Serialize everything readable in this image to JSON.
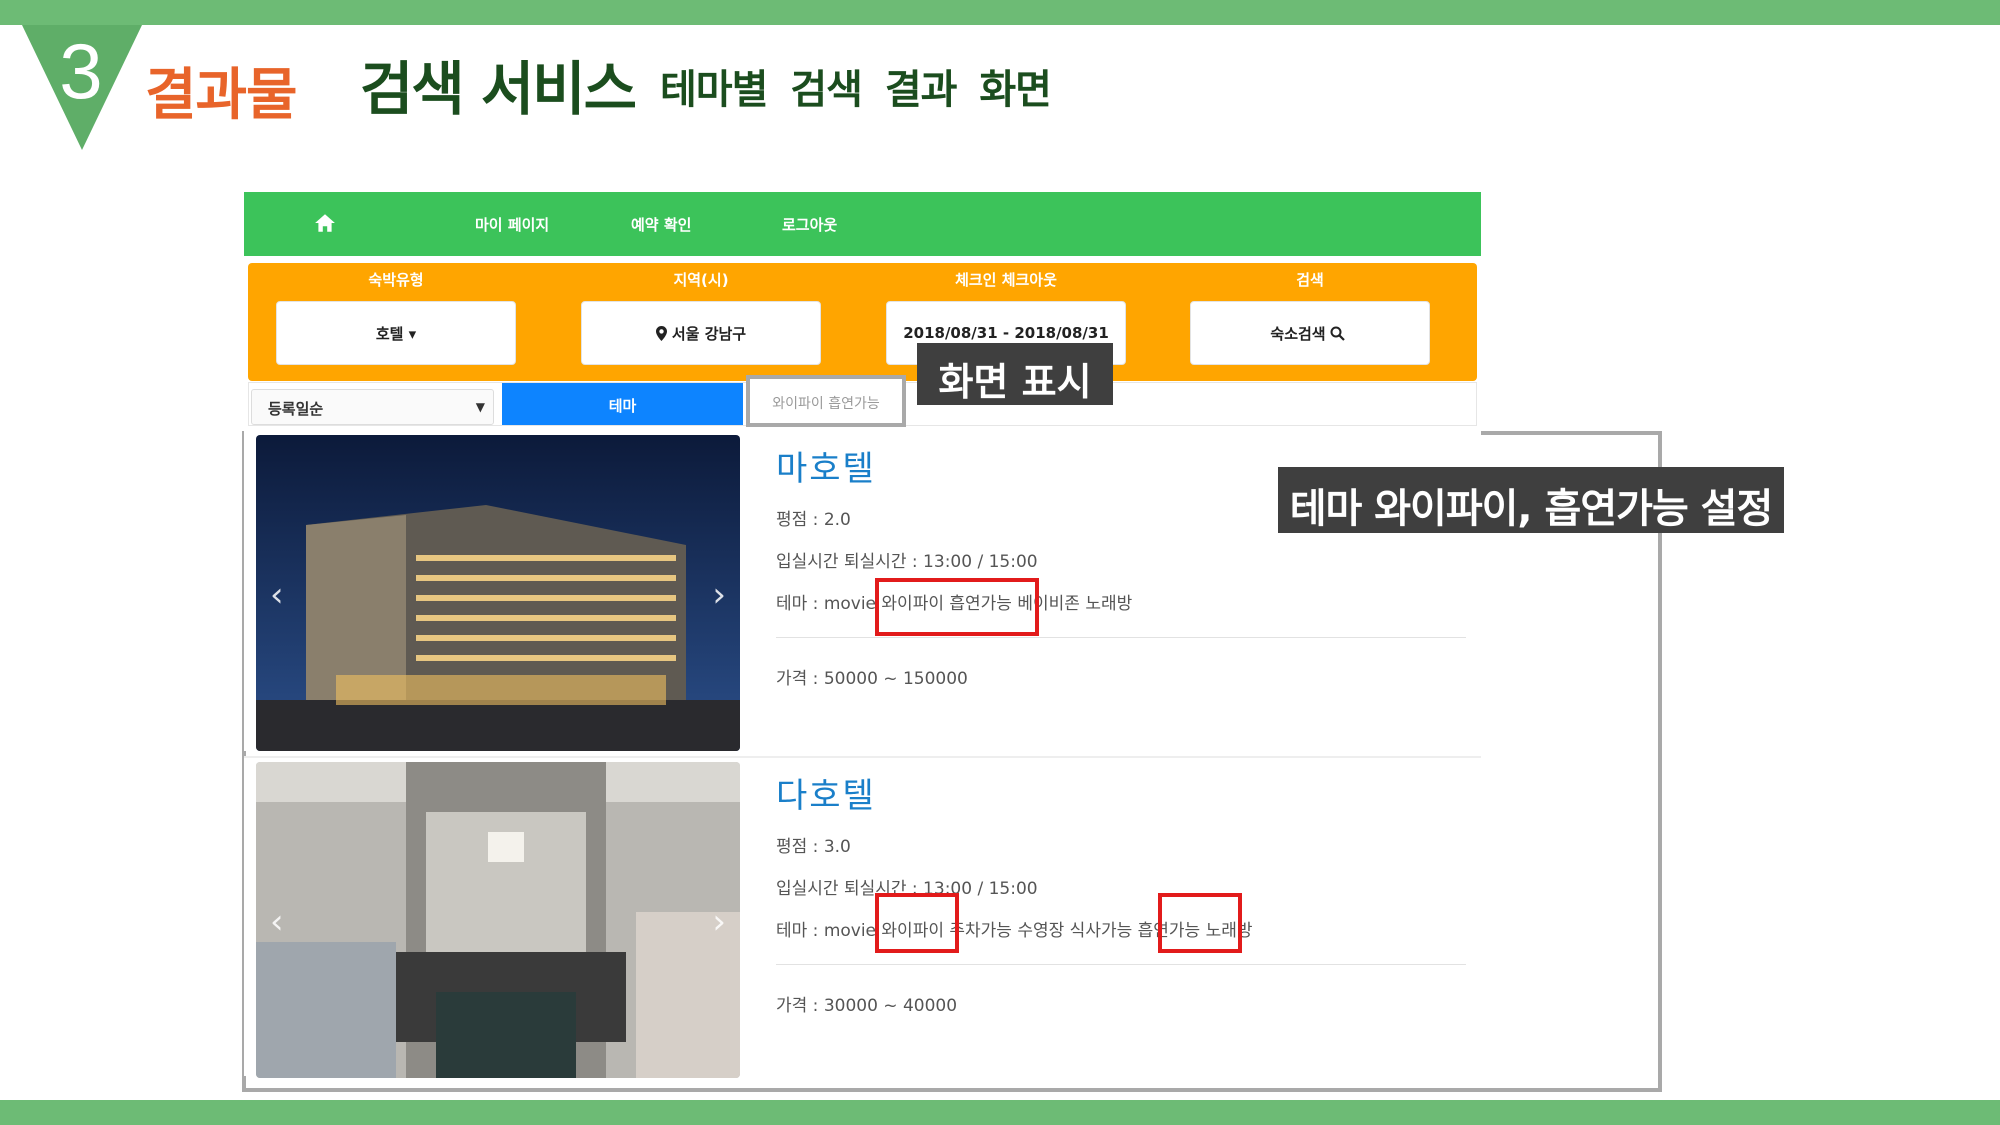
{
  "slide": {
    "section_number": "3",
    "section_title": "결과물",
    "title": "검색 서비스",
    "subtitle": "테마별  검색 결과 화면"
  },
  "nav": {
    "home_icon": "home-icon",
    "links": [
      "마이 페이지",
      "예약 확인",
      "로그아웃"
    ]
  },
  "search": {
    "fields": [
      {
        "label": "숙박유형",
        "value": "호텔 ▾"
      },
      {
        "label": "지역(시)",
        "value": "서울 강남구",
        "icon": "map-pin-icon"
      },
      {
        "label": "체크인 체크아웃",
        "value": "2018/08/31 - 2018/08/31"
      },
      {
        "label": "검색",
        "value": "숙소검색",
        "icon": "search-icon"
      }
    ]
  },
  "filter": {
    "sort_value": "등록일순",
    "theme_button": "테마",
    "theme_tag": "와이파이 흡연가능"
  },
  "callouts": {
    "screen": "화면 표시",
    "theme_setting": "테마 와이파이, 흡연가능 설정"
  },
  "hotels": [
    {
      "name": "마호텔",
      "rating": "평점 : 2.0",
      "times": "입실시간 퇴실시간 : 13:00 / 15:00",
      "themes": "테마 : movie 와이파이 흡연가능 베이비존 노래방",
      "price": "가격 : 50000 ~ 150000"
    },
    {
      "name": "다호텔",
      "rating": "평점 : 3.0",
      "times": "입실시간 퇴실시간 : 13:00 / 15:00",
      "themes": "테마 : movie 와이파이 주차가능 수영장 식사가능 흡연가능 노래방",
      "price": "가격 : 30000 ~ 40000"
    }
  ],
  "colors": {
    "nav_green": "#3cc35a",
    "search_orange": "#ffa500",
    "theme_blue": "#0d84ff",
    "slide_green": "#6dbb75",
    "accent_orange": "#e8642a",
    "highlight_red": "#e21b1b"
  }
}
